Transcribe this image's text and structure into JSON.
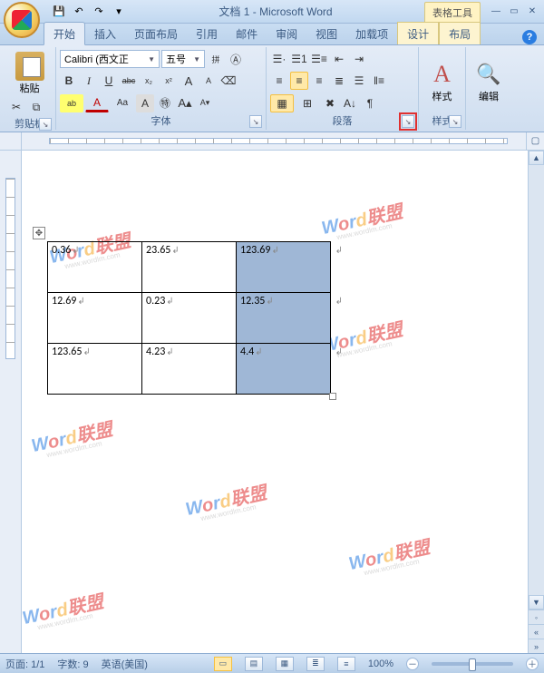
{
  "title": "文档 1 - Microsoft Word",
  "context_tab": "表格工具",
  "tabs": [
    "开始",
    "插入",
    "页面布局",
    "引用",
    "邮件",
    "审阅",
    "视图",
    "加载项",
    "设计",
    "布局"
  ],
  "active_tab_index": 0,
  "qat": {
    "save": "保存",
    "undo": "撤销",
    "redo": "重做"
  },
  "window_controls": {
    "min": "最小化",
    "restore": "还原",
    "close": "关闭"
  },
  "ribbon": {
    "clipboard": {
      "label": "剪贴板",
      "paste": "粘贴"
    },
    "font": {
      "label": "字体",
      "font_name": "Calibri (西文正",
      "font_size": "五号",
      "buttons": {
        "bold": "B",
        "italic": "I",
        "underline": "U",
        "strike": "abc",
        "sub": "x₂",
        "sup": "x²",
        "highlight": "ab",
        "fontcolor": "A",
        "changecase": "Aa",
        "charshading": "A",
        "grow": "A",
        "shrink": "A",
        "clear": "⌫",
        "phonetic": "拼"
      }
    },
    "paragraph": {
      "label": "段落"
    },
    "styles": {
      "label": "样式",
      "button": "样式"
    },
    "editing": {
      "label": "编辑",
      "button": "编辑",
      "find_icon": "查找"
    }
  },
  "table": {
    "rows": [
      {
        "cells": [
          "0.36",
          "23.65",
          "123.69"
        ],
        "selected_col": 2
      },
      {
        "cells": [
          "12.69",
          "0.23",
          "12.35"
        ],
        "selected_col": 2
      },
      {
        "cells": [
          "123.65",
          "4.23",
          "4.4"
        ],
        "selected_col": 2
      }
    ]
  },
  "watermark": {
    "text_en": "Word",
    "text_cn": "联盟",
    "url": "www.wordlm.com"
  },
  "status": {
    "page": "页面: 1/1",
    "words": "字数: 9",
    "lang": "英语(美国)",
    "zoom": "100%",
    "zoom_minus": "－",
    "zoom_plus": "＋"
  }
}
